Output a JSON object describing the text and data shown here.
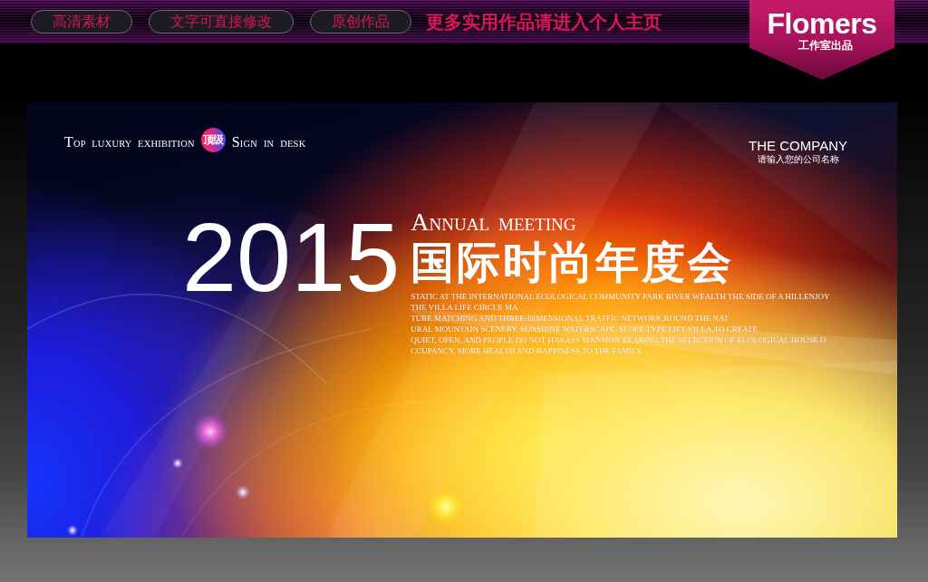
{
  "promo_bar": {
    "tags": [
      "高清素材",
      "文字可直接修改",
      "原创作品"
    ],
    "headline": "更多实用作品请进入个人主页",
    "brand": {
      "name": "Flomers",
      "subtitle": "工作室出品"
    }
  },
  "poster": {
    "tagline": {
      "before": "TOP LUXURY EXHIBITION",
      "seal": "顶级",
      "after": "SIGN IN DESK"
    },
    "company": {
      "name": "THE COMPANY",
      "note": "请输入您的公司名称"
    },
    "year": "2015",
    "subtitle": "ANNUAL MEETING",
    "title": "国际时尚年度会",
    "body_lines": [
      "STATIC AT THE INTERNATIONAL ECOLOGICAL COMMUNITY PARK RIVER WEALTH THE SIDE OF A HILLENJOY",
      "THE VILLA LIFE CIRCLE MA",
      "TURE MATCHING AND THREE-DIMENSIONAL TRAFFIC NETWORK,ROUND THE NAT",
      "URAL MOUNTAIN SCENERY, SUNSHINE WATERSCAPE, SLOPE TYPE LIFT VILLA,TO CREATE",
      "QUIET, OPEN, AND PEOPLE DO NOT HARASS MANSION BEARING,THE SELECTION OF ECOLOGICAL HOUSE O",
      "CCUPANCY, MORE HEALTH AND HAPPINESS TO THE FAMILY."
    ]
  }
}
